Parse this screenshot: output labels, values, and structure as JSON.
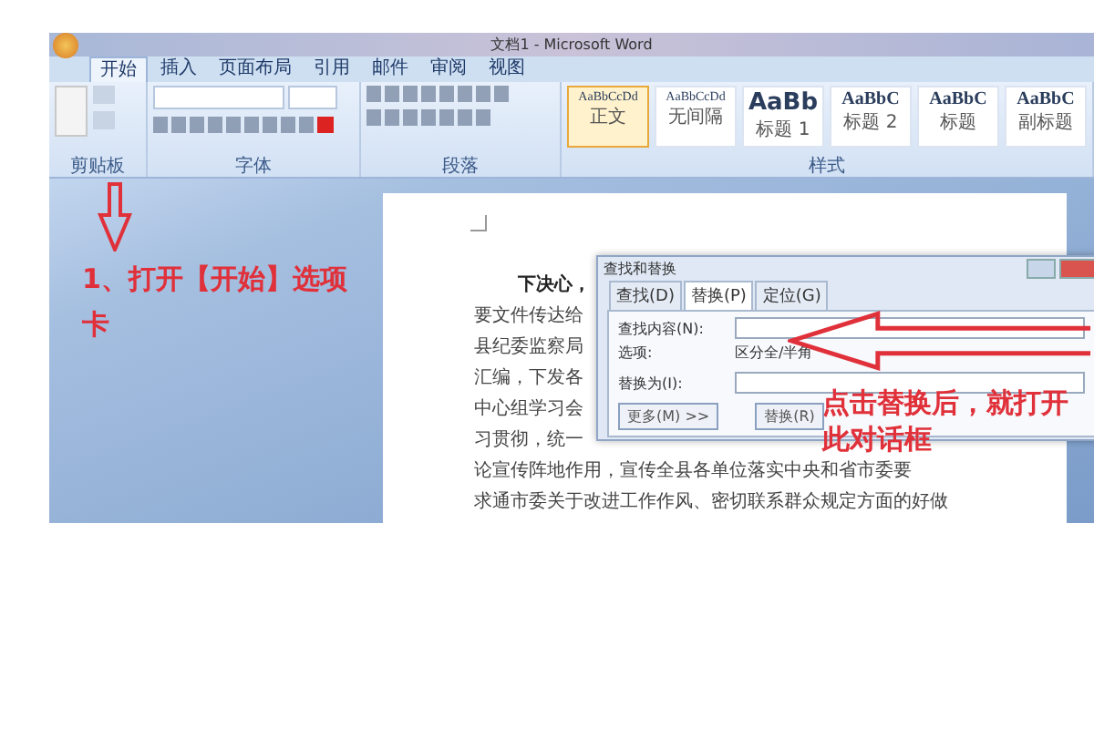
{
  "window": {
    "title": "文档1 - Microsoft Word"
  },
  "tabs": [
    {
      "label": "开始",
      "selected": true
    },
    {
      "label": "插入",
      "selected": false
    },
    {
      "label": "页面布局",
      "selected": false
    },
    {
      "label": "引用",
      "selected": false
    },
    {
      "label": "邮件",
      "selected": false
    },
    {
      "label": "审阅",
      "selected": false
    },
    {
      "label": "视图",
      "selected": false
    }
  ],
  "ribbon": {
    "groups": [
      {
        "label": "剪贴板"
      },
      {
        "label": "字体"
      },
      {
        "label": "段落"
      },
      {
        "label": "样式"
      }
    ],
    "styles": [
      {
        "sample": "AaBbCcDd",
        "name": "正文",
        "selected": true
      },
      {
        "sample": "AaBbCcDd",
        "name": "无间隔",
        "selected": false
      },
      {
        "sample": "AaBb",
        "name": "标题 1",
        "selected": false
      },
      {
        "sample": "AaBbC",
        "name": "标题 2",
        "selected": false
      },
      {
        "sample": "AaBbC",
        "name": "标题",
        "selected": false
      },
      {
        "sample": "AaBbC",
        "name": "副标题",
        "selected": false
      }
    ]
  },
  "document": {
    "lines": [
      {
        "kind": "lead",
        "text": "下决心，"
      },
      {
        "kind": "body",
        "text": "要文件传达给"
      },
      {
        "kind": "body",
        "text": "县纪委监察局"
      },
      {
        "kind": "body",
        "text": "汇编，下发各"
      },
      {
        "kind": "body",
        "text": "中心组学习会"
      },
      {
        "kind": "body",
        "text": "习贯彻，统一"
      },
      {
        "kind": "body",
        "text": "论宣传阵地作用，宣传全县各单位落实中央和省市委要"
      },
      {
        "kind": "body",
        "text": "求通市委关于改进工作作风、密切联系群众规定方面的好做"
      }
    ]
  },
  "dialog": {
    "title": "查找和替换",
    "tabs": [
      {
        "label": "查找(D)",
        "selected": false
      },
      {
        "label": "替换(P)",
        "selected": true
      },
      {
        "label": "定位(G)",
        "selected": false
      }
    ],
    "find_label": "查找内容(N):",
    "options_label": "选项:",
    "options_value": "区分全/半角",
    "replace_label": "替换为(I):",
    "buttons": [
      "更多(M) >>",
      "替换(R)"
    ]
  },
  "annotations": [
    {
      "text": "1、打开【开始】选项卡"
    },
    {
      "text": "点击替换后，就打开此对话框"
    }
  ]
}
